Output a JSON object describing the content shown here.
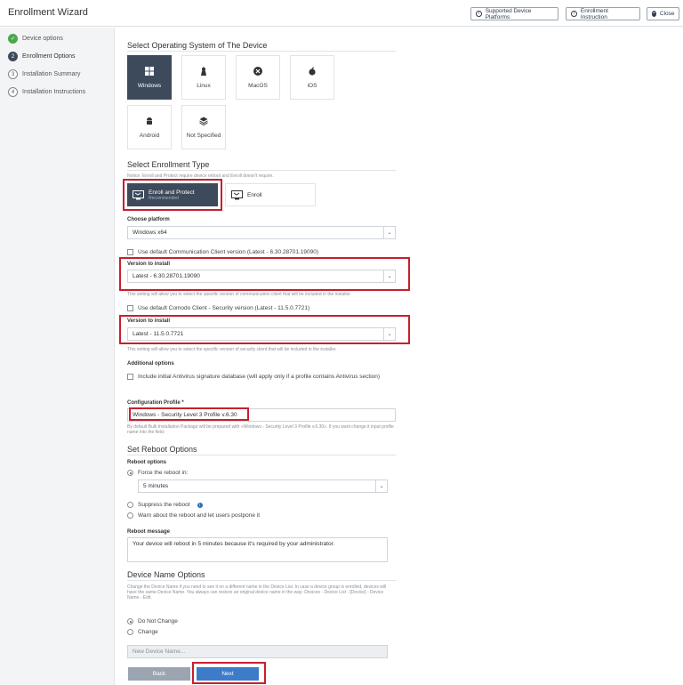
{
  "header": {
    "title": "Enrollment Wizard",
    "supported_platforms": "Supported Device Platforms",
    "enrollment_instruction": "Enrollment Instruction",
    "close": "Close"
  },
  "sidebar": {
    "steps": [
      {
        "num": "✓",
        "label": "Device options",
        "state": "done"
      },
      {
        "num": "2",
        "label": "Enrollment Options",
        "state": "active"
      },
      {
        "num": "3",
        "label": "Installation Summary",
        "state": "pending"
      },
      {
        "num": "4",
        "label": "Installation Instructions",
        "state": "pending"
      }
    ]
  },
  "os": {
    "title": "Select Operating System of The Device",
    "tiles": [
      {
        "label": "Windows",
        "icon": "windows-icon"
      },
      {
        "label": "Linux",
        "icon": "linux-icon"
      },
      {
        "label": "MacOS",
        "icon": "macos-icon"
      },
      {
        "label": "iOS",
        "icon": "apple-icon"
      },
      {
        "label": "Android",
        "icon": "android-icon"
      },
      {
        "label": "Not Specified",
        "icon": "layers-icon"
      }
    ],
    "selected": "Windows"
  },
  "enrollment": {
    "title": "Select Enrollment Type",
    "notice": "Notice: Enroll and Protect require device reboot and Enroll doesn't require.",
    "enroll_protect": "Enroll and Protect",
    "recommended": "Recommended",
    "enroll": "Enroll",
    "choose_platform_label": "Choose platform",
    "platform_value": "Windows x64",
    "use_default_comm": "Use default Communication Client version (Latest - 6.30.28701.19090)",
    "version_label_1": "Version to install",
    "version_value_1": "Latest - 6.30.28701.19090",
    "version_note_1": "This setting will allow you to select the specific version of communication client that will be included in the installer.",
    "use_default_security": "Use default Comodo Client - Security version (Latest - 11.5.0.7721)",
    "version_label_2": "Version to install",
    "version_value_2": "Latest - 11.5.0.7721",
    "version_note_2": "This setting will allow you to select the specific version of security client that will be included in the installer.",
    "additional_label": "Additional options",
    "include_av": "Include initial Antivirus signature database (will apply only if a profile contains Antivirus section)",
    "config_profile_label": "Configuration Profile *",
    "config_profile_value": "Windows - Security Level 3 Profile v.6.30",
    "config_note": "By default Bulk Installation Package will be prepared with «Windows - Security Level 3 Profile v.6.30». If you want change it input profile name into the field."
  },
  "reboot": {
    "title": "Set Reboot Options",
    "options_label": "Reboot options",
    "force": "Force the reboot in:",
    "delay_value": "5 minutes",
    "suppress": "Suppress the reboot",
    "warn": "Warn about the reboot and let users postpone it",
    "message_label": "Reboot message",
    "message_value": "Your device will reboot in 5 minutes because it's required by your administrator."
  },
  "device_name": {
    "title": "Device Name Options",
    "description": "Change the Device Name if you need to see it on a different name in the Device List. In case a device group is enrolled, devices will have the same Device Name. You always can restore an original device name in the way: Devices - Device List - [Device] - Device Name - Edit.",
    "do_not_change": "Do Not Change",
    "change": "Change",
    "placeholder": "New Device Name..."
  },
  "footer": {
    "back": "Back",
    "next": "Next"
  },
  "colors": {
    "selected_tile": "#3d4a5c",
    "highlight_box": "#c7202e",
    "next_button": "#3d7cc9",
    "done_step": "#4aa84a"
  }
}
